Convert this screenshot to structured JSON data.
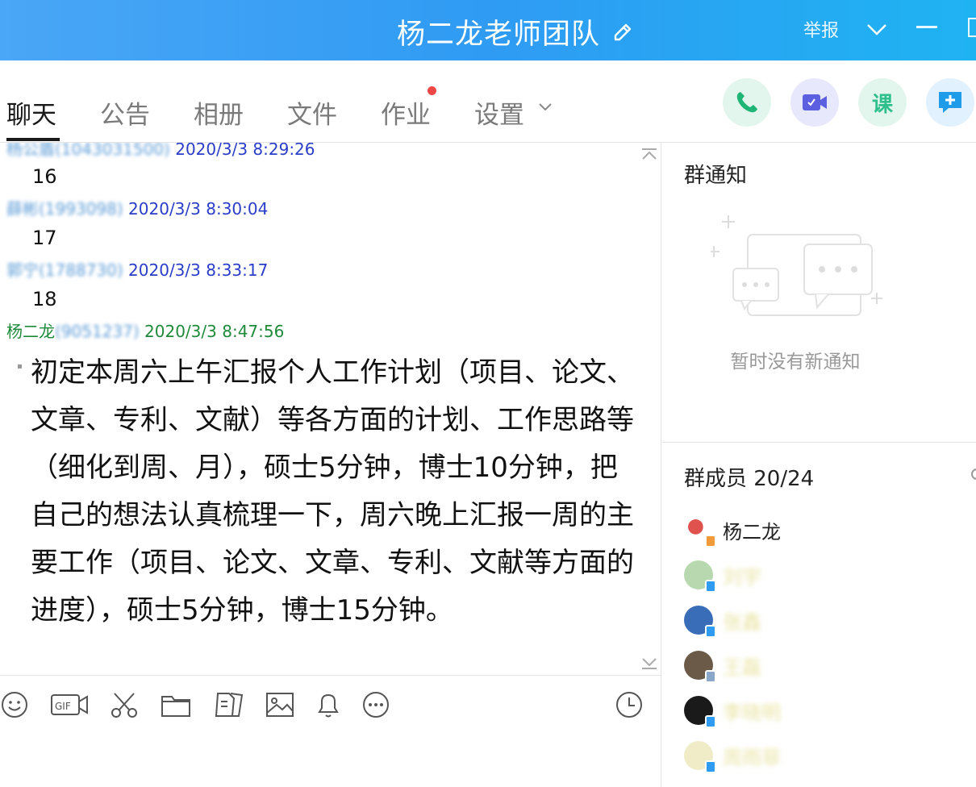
{
  "window": {
    "title": "杨二龙老师团队",
    "report_label": "举报"
  },
  "tabs": [
    {
      "label": "聊天",
      "active": true
    },
    {
      "label": "公告"
    },
    {
      "label": "相册"
    },
    {
      "label": "文件"
    },
    {
      "label": "作业",
      "has_dot": true
    },
    {
      "label": "设置"
    }
  ],
  "actions": {
    "course_label": "课"
  },
  "chat": {
    "messages": [
      {
        "sender": "杨公盾",
        "sender_id": "(1043031500)",
        "time": "2020/3/3 8:29:26",
        "text": "16"
      },
      {
        "sender": "薛彬",
        "sender_id": "(1993098)",
        "time": "2020/3/3 8:30:04",
        "text": "17"
      },
      {
        "sender": "郭宁",
        "sender_id": "(1788730)",
        "time": "2020/3/3 8:33:17",
        "text": "18"
      },
      {
        "sender": "杨二龙",
        "sender_id": "(9051237)",
        "time": "2020/3/3 8:47:56",
        "text": "初定本周六上午汇报个人工作计划（项目、论文、文章、专利、文献）等各方面的计划、工作思路等（细化到周、月），硕士5分钟，博士10分钟，把自己的想法认真梳理一下，周六晚上汇报一周的主要工作（项目、论文、文章、专利、文献等方面的进度），硕士5分钟，博士15分钟。"
      }
    ]
  },
  "notice": {
    "title": "群通知",
    "empty_text": "暂时没有新通知"
  },
  "members": {
    "title": "群成员 20/24",
    "list": [
      {
        "name": "杨二龙",
        "color": "#c83a3a"
      },
      {
        "name": "刘宇",
        "color": "#8bbf8b"
      },
      {
        "name": "张鑫",
        "color": "#2f5fa6"
      },
      {
        "name": "王磊",
        "color": "#5a4a3a"
      },
      {
        "name": "李晓明",
        "color": "#1a1a1a"
      },
      {
        "name": "周雨菲",
        "color": "#f1ecc8"
      }
    ]
  },
  "colors": {
    "title_bar": "#2f9bf3",
    "sender_name": "#1f8a3a",
    "timestamp": "#2a3dc8"
  }
}
